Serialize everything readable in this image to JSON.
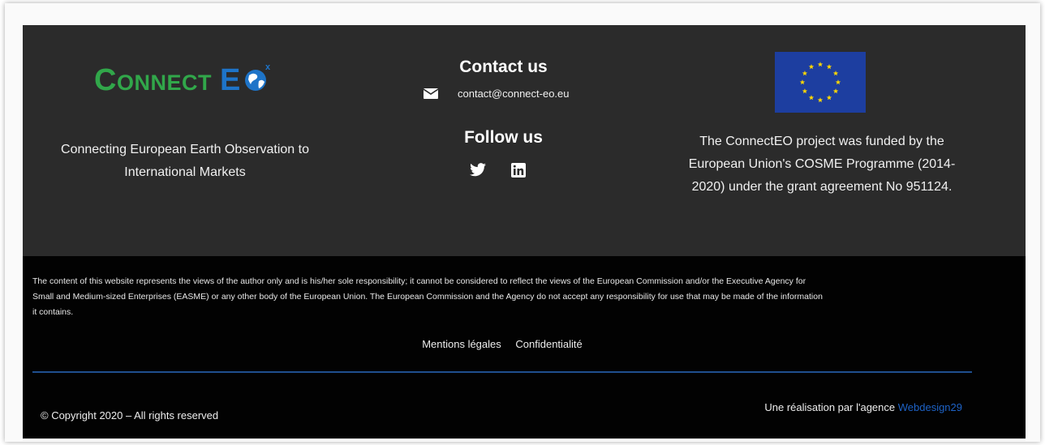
{
  "brand": {
    "logo_word1": "Connect",
    "logo_word2": "E",
    "tagline_line1": "Connecting European Earth Observation to",
    "tagline_line2": "International Markets"
  },
  "contact": {
    "title": "Contact us",
    "email": "contact@connect-eo.eu",
    "icon": "mail-icon"
  },
  "follow": {
    "title": "Follow us",
    "icons": [
      "twitter-icon",
      "linkedin-icon"
    ]
  },
  "funding": {
    "line1": "The ConnectEO project was funded by the",
    "line2": "European Union's COSME Programme (2014-",
    "line3": "2020) under the grant agreement No 951124."
  },
  "disclaimer": {
    "line1": "The content of this website represents the views of the author only and is his/her sole responsibility; it cannot be considered to reflect the views of the European Commission and/or the Executive Agency for",
    "line2": "Small and Medium-sized Enterprises (EASME) or any other body of the European Union. The European Commission and the Agency do not accept any responsibility for use that may be made of the information",
    "line3": "it contains."
  },
  "legal": {
    "mentions": "Mentions légales",
    "privacy": "Confidentialité"
  },
  "copyright": "© Copyright 2020 – All rights reserved",
  "credit": {
    "prefix": "Une réalisation par l'agence",
    "agency": "Webdesign29"
  },
  "colors": {
    "footer_bg": "#2b2b2b",
    "bottom_bg": "#020202",
    "logo_green": "#31a74a",
    "logo_blue": "#1e74c8",
    "eu_blue": "#1d3ea0",
    "eu_yellow": "#ffd700",
    "divider": "#1f4f8f",
    "link_blue": "#1e63c7"
  }
}
